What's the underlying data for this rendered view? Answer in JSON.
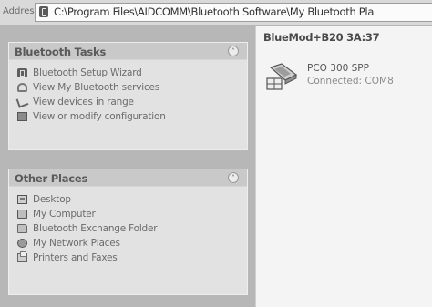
{
  "address_bar": {
    "label": "Address",
    "path": "C:\\Program Files\\AIDCOMM\\Bluetooth Software\\My Bluetooth Pla"
  },
  "tasks_panel": {
    "title": "Bluetooth Tasks",
    "items": [
      {
        "label": "Bluetooth Setup Wizard",
        "icon": "bluetooth-icon"
      },
      {
        "label": "View My Bluetooth services",
        "icon": "bluetooth-services-icon"
      },
      {
        "label": "View devices in range",
        "icon": "devices-in-range-icon"
      },
      {
        "label": "View or modify configuration",
        "icon": "configuration-icon"
      }
    ]
  },
  "places_panel": {
    "title": "Other Places",
    "items": [
      {
        "label": "Desktop",
        "icon": "desktop-icon"
      },
      {
        "label": "My Computer",
        "icon": "computer-icon"
      },
      {
        "label": "Bluetooth Exchange Folder",
        "icon": "folder-icon"
      },
      {
        "label": "My Network Places",
        "icon": "network-icon"
      },
      {
        "label": "Printers and Faxes",
        "icon": "printer-icon"
      }
    ]
  },
  "content": {
    "title": "BlueMod+B20 3A:37",
    "device": {
      "name": "PCO 300 SPP",
      "status": "Connected: COM8",
      "icon": "serial-port-device-icon"
    }
  },
  "colors": {
    "pane_background": "#b7b7b7",
    "panel_background": "#e2e2e2",
    "content_background": "#f4f4f4"
  }
}
